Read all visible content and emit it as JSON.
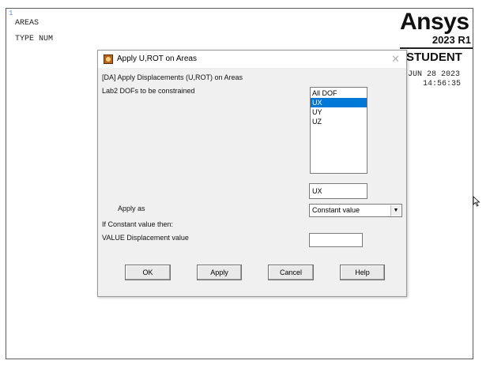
{
  "graphics": {
    "window_number": "1",
    "labels": [
      "AREAS",
      "TYPE NUM"
    ],
    "logo": {
      "brand": "Ansys",
      "version": "2023 R1",
      "edition": "STUDENT"
    },
    "date": "JUN 28 2023",
    "time": "14:56:35",
    "cursor_icon": "resize-cursor-icon"
  },
  "dialog": {
    "title": "Apply U,ROT on Areas",
    "title_icon": "ansys-app-icon",
    "close_icon": "close-icon",
    "heading": "[DA]  Apply Displacements (U,ROT) on Areas",
    "lab2_label": "Lab2   DOFs to be constrained",
    "dof_options": [
      "All DOF",
      "UX",
      "UY",
      "UZ"
    ],
    "dof_selected": "UX",
    "dof_field_value": "UX",
    "apply_as_label": "Apply as",
    "apply_as_value": "Constant value",
    "constant_hint": "If Constant value then:",
    "value_label": "VALUE   Displacement value",
    "value_field": "",
    "buttons": {
      "ok": "OK",
      "apply": "Apply",
      "cancel": "Cancel",
      "help": "Help"
    }
  }
}
